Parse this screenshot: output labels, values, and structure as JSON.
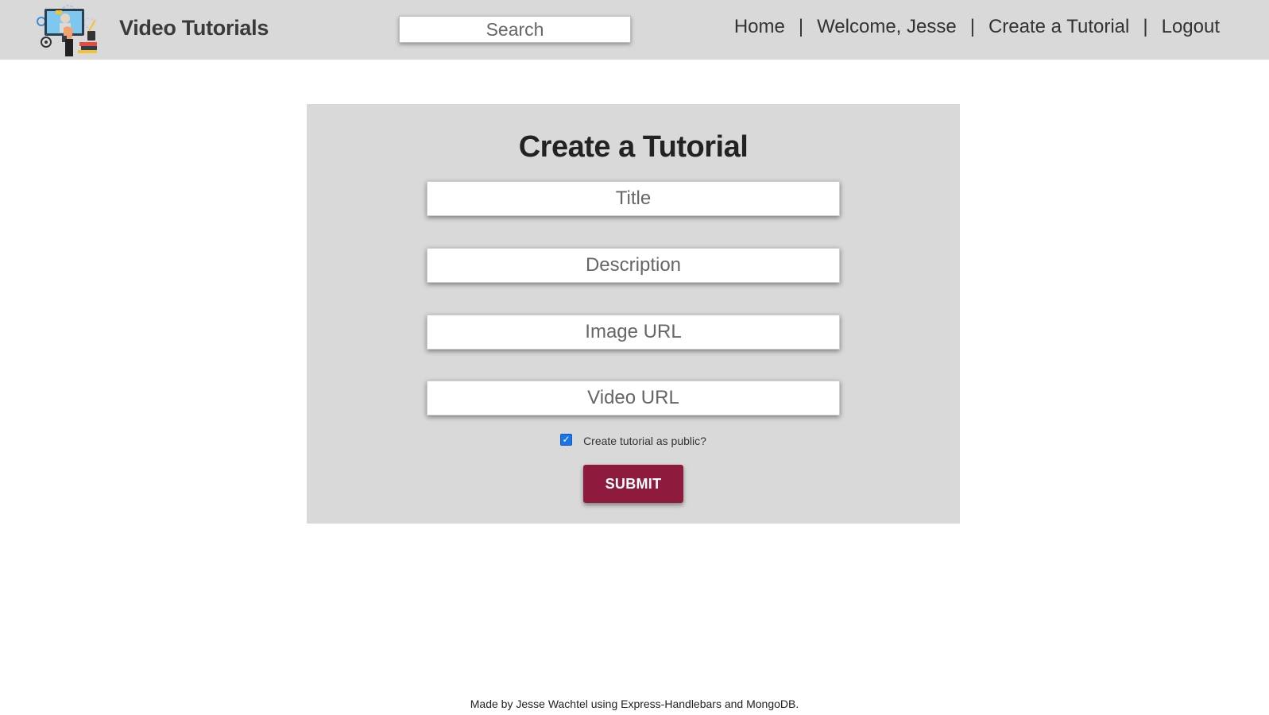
{
  "header": {
    "brand": "Video Tutorials",
    "logo_icon": "video-tutorial-logo",
    "search_placeholder": "Search",
    "nav": {
      "home": "Home",
      "welcome": "Welcome, Jesse",
      "create": "Create a Tutorial",
      "logout": "Logout",
      "separator": "|"
    }
  },
  "form": {
    "title": "Create a Tutorial",
    "title_placeholder": "Title",
    "description_placeholder": "Description",
    "image_url_placeholder": "Image URL",
    "video_url_placeholder": "Video URL",
    "public_label": "Create tutorial as public?",
    "public_checked": true,
    "submit_label": "SUBMIT"
  },
  "footer": {
    "text": "Made by Jesse Wachtel using Express-Handlebars and MongoDB."
  },
  "colors": {
    "header_bg": "#d9d9d9",
    "card_bg": "#d9d9d9",
    "submit_bg": "#8e1b3e",
    "checkbox": "#1a73e8"
  }
}
